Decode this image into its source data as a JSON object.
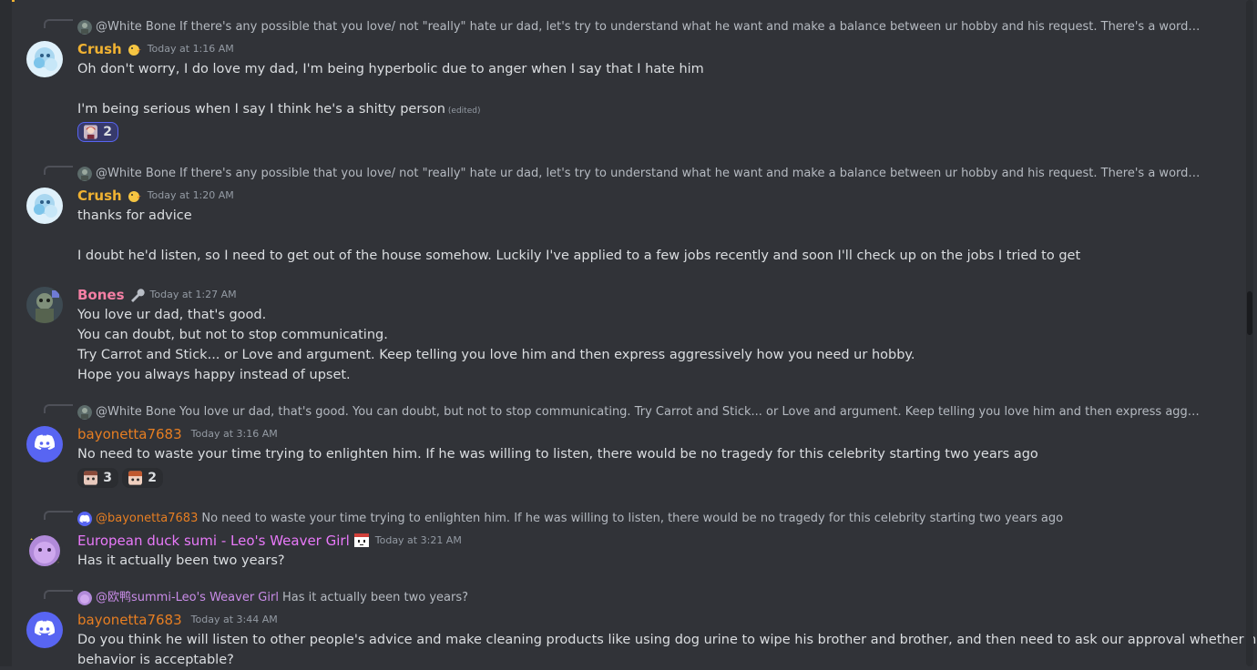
{
  "messages": [
    {
      "reply": {
        "author": "@White Bone",
        "text": "If there's any possible that you love/ not \"really\" hate ur dad, let's try to understand what he want and make a balance between ur hobby and his request.  There's a word in Japanese called …"
      },
      "author": "Crush",
      "author_color": "#f0b232",
      "badge": "chick-icon",
      "time": "Today at 1:16 AM",
      "lines": [
        "Oh don't worry, I do love my dad, I'm being hyperbolic due to anger when I say that I hate him",
        "",
        "I'm being serious when I say I think he's  a shitty person"
      ],
      "edited": "(edited)",
      "reactions": [
        {
          "emoji": "anime-girl-emoji",
          "count": "2",
          "active": true
        }
      ]
    },
    {
      "reply": {
        "author": "@White Bone",
        "text": "If there's any possible that you love/ not \"really\" hate ur dad, let's try to understand what he want and make a balance between ur hobby and his request.  There's a word in Japanese called …"
      },
      "author": "Crush",
      "author_color": "#f0b232",
      "badge": "chick-icon",
      "time": "Today at 1:20 AM",
      "lines": [
        "thanks for advice",
        "",
        "I doubt he'd listen, so I need to get out of the house somehow. Luckily I've applied to a few jobs recently and soon I'll check up on the jobs I tried to get"
      ]
    },
    {
      "author": "Bones",
      "author_color": "#f47fa4",
      "badge": "wrench-icon",
      "time": "Today at 1:27 AM",
      "lines": [
        "You love ur dad, that's good.",
        "You can doubt, but not to stop communicating.",
        "Try Carrot and Stick... or Love and argument. Keep telling you love him and then express aggressively how you need ur hobby.",
        "Hope you always happy instead of upset."
      ]
    },
    {
      "reply": {
        "author": "@White Bone",
        "text": "You love ur dad, that's good. You can doubt, but not to stop communicating. Try Carrot and Stick... or Love and argument. Keep telling you love him and then express aggressively how you ne…"
      },
      "author": "bayonetta7683",
      "author_color": "#e67e22",
      "time": "Today at 3:16 AM",
      "lines": [
        "No need to waste your time trying to enlighten him. If he was willing to listen, there would be no tragedy for this celebrity starting two years ago"
      ],
      "reactions": [
        {
          "emoji": "anime-face-emoji",
          "count": "3",
          "active": false
        },
        {
          "emoji": "anime-face-emoji-2",
          "count": "2",
          "active": false
        }
      ]
    },
    {
      "reply": {
        "author": "@bayonetta7683",
        "text": "No need to waste your time trying to enlighten him. If he was willing to listen, there would be no tragedy for this celebrity starting two years ago"
      },
      "author": "European duck sumi - Leo's Weaver Girl",
      "author_color": "#e879f9",
      "badge": "pixel-face-icon",
      "time": "Today at 3:21 AM",
      "lines": [
        "Has it actually been two years?"
      ]
    },
    {
      "reply": {
        "author": "@欧鸭summi-Leo's Weaver Girl",
        "text": "Has it actually been two years?"
      },
      "author": "bayonetta7683",
      "author_color": "#e67e22",
      "time": "Today at 3:44 AM",
      "lines": [
        "Do you think he will listen to other people's advice and make cleaning products like using dog urine to wipe his brother and brother, and then need to ask our approval whether his",
        "behavior is acceptable?"
      ]
    }
  ],
  "colors": {
    "background": "#313338",
    "text": "#dbdee1",
    "muted": "#949ba4",
    "blurple": "#5865f2"
  }
}
